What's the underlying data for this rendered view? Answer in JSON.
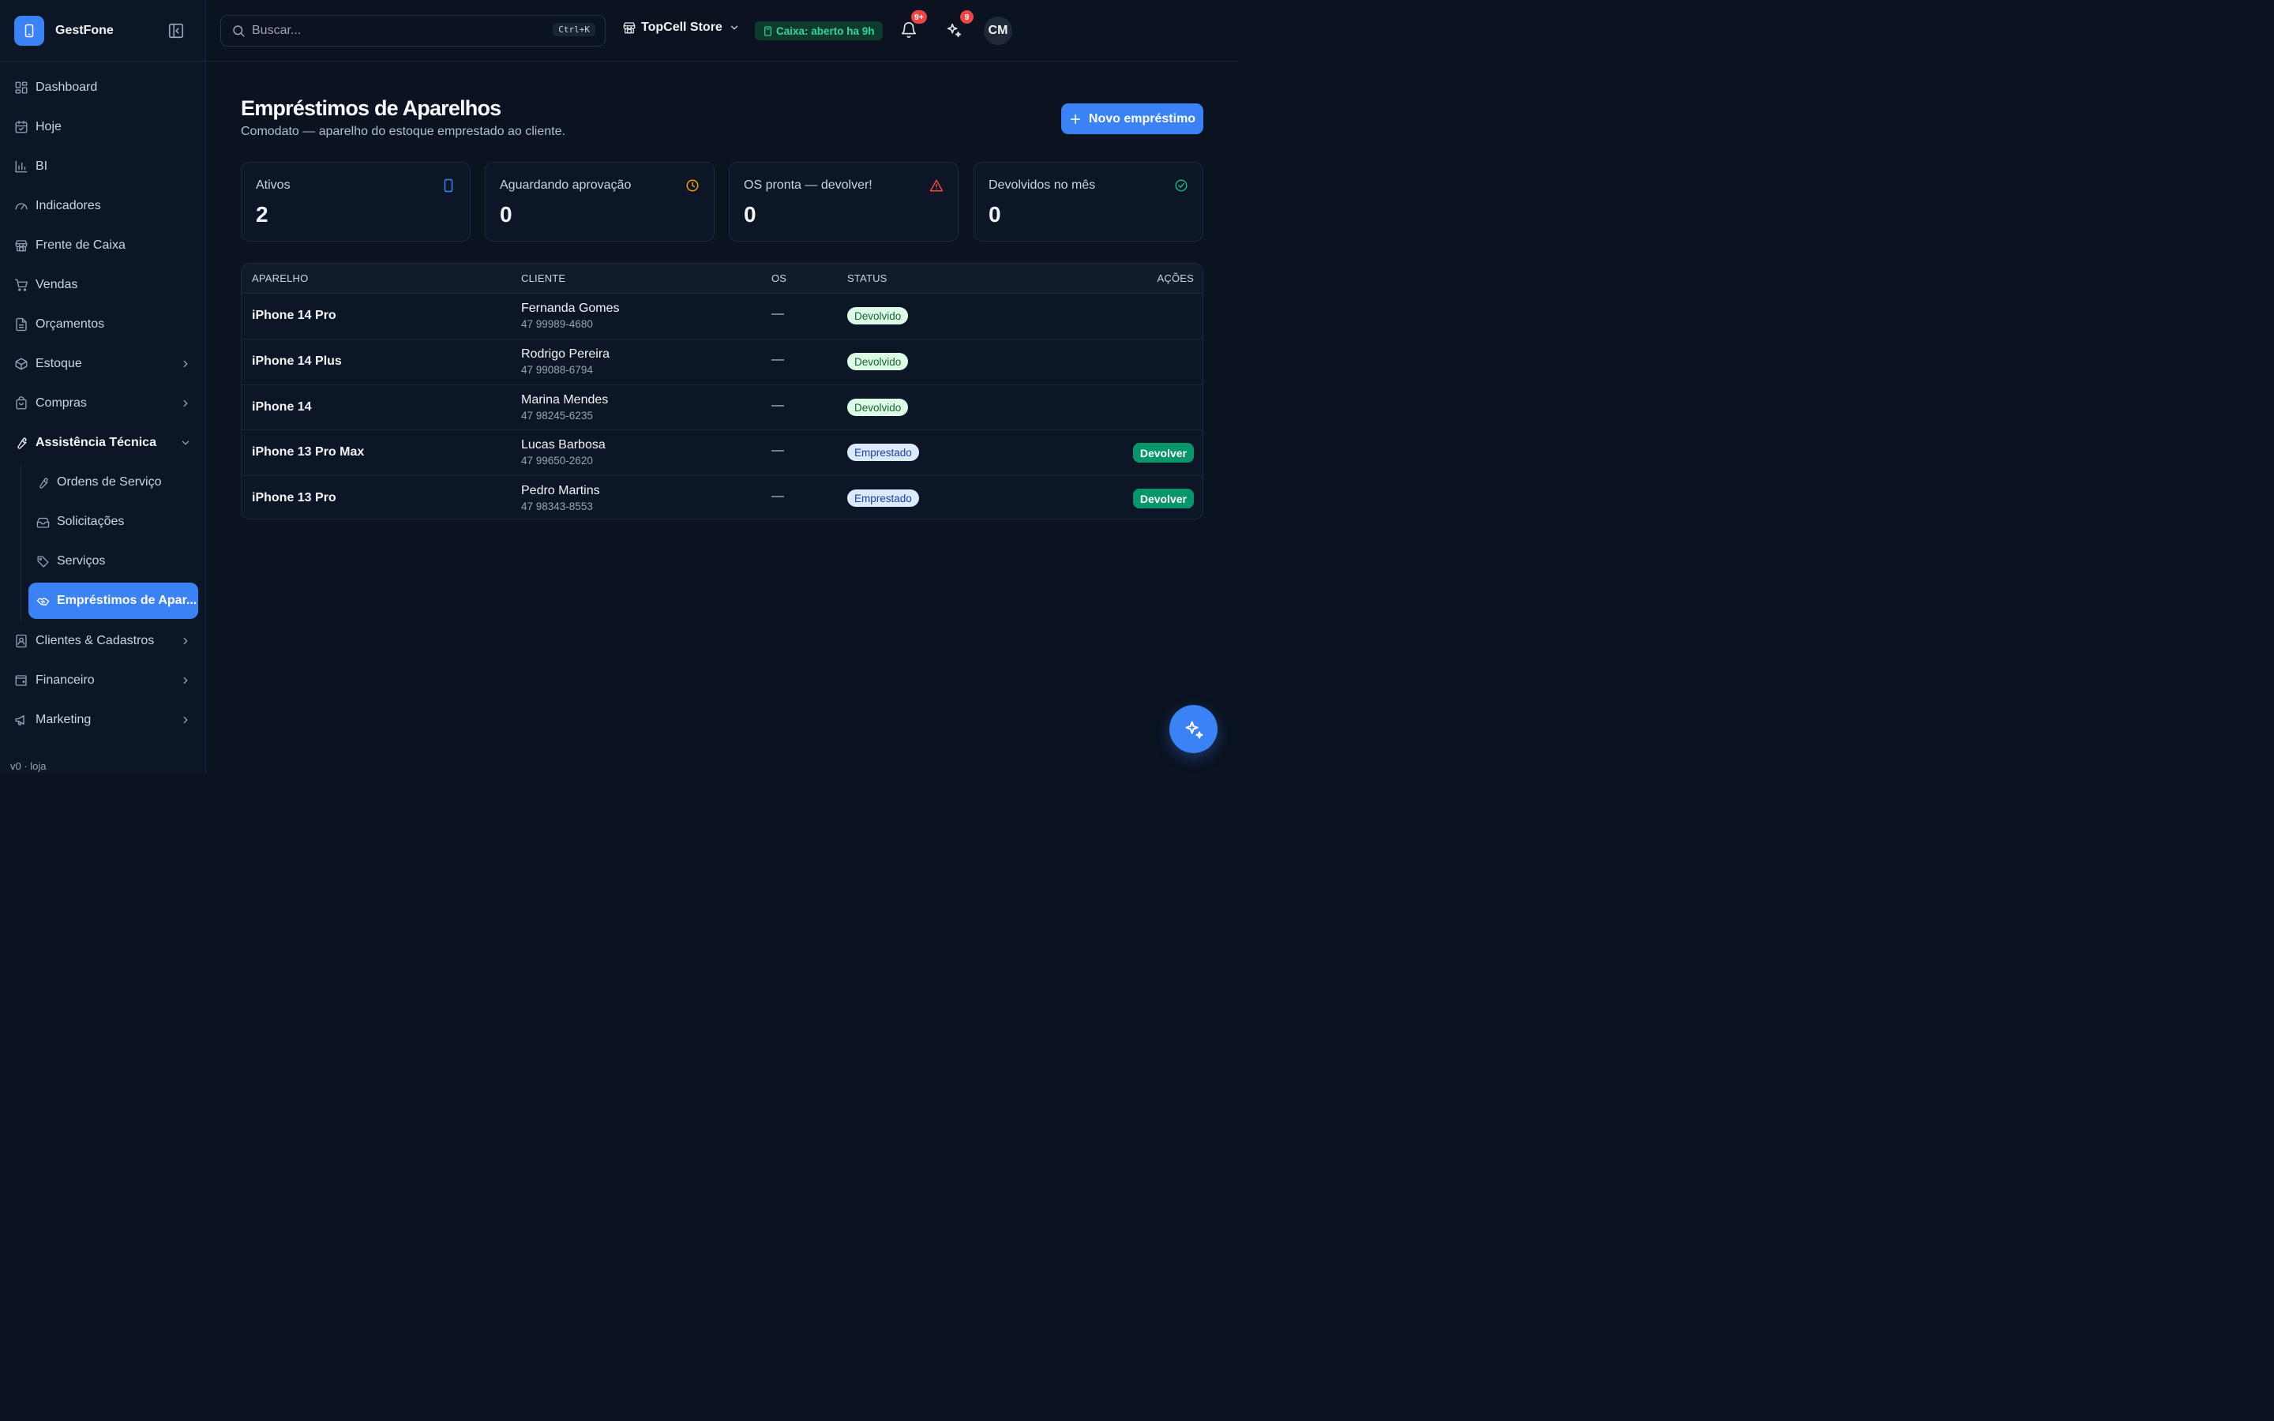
{
  "brand": {
    "name": "GestFone"
  },
  "sidebar": {
    "items": [
      {
        "label": "Dashboard",
        "icon": "dashboard-icon"
      },
      {
        "label": "Hoje",
        "icon": "calendar-icon"
      },
      {
        "label": "BI",
        "icon": "bar-chart-icon"
      },
      {
        "label": "Indicadores",
        "icon": "gauge-icon"
      },
      {
        "label": "Frente de Caixa",
        "icon": "store-icon"
      },
      {
        "label": "Vendas",
        "icon": "cart-icon"
      },
      {
        "label": "Orçamentos",
        "icon": "document-icon"
      },
      {
        "label": "Estoque",
        "icon": "package-icon"
      },
      {
        "label": "Compras",
        "icon": "shopping-bag-icon"
      },
      {
        "label": "Assistência Técnica",
        "icon": "wrench-icon"
      },
      {
        "label": "Clientes & Cadastros",
        "icon": "contact-icon"
      },
      {
        "label": "Financeiro",
        "icon": "wallet-icon"
      },
      {
        "label": "Marketing",
        "icon": "megaphone-icon"
      }
    ],
    "subitems": [
      {
        "label": "Ordens de Serviço",
        "icon": "wrench-icon"
      },
      {
        "label": "Solicitações",
        "icon": "inbox-icon"
      },
      {
        "label": "Serviços",
        "icon": "tags-icon"
      },
      {
        "label": "Empréstimos de Apar...",
        "icon": "handshake-icon"
      }
    ],
    "version": "v0 · loja"
  },
  "topbar": {
    "search_placeholder": "Buscar...",
    "search_shortcut": "Ctrl+K",
    "store_name": "TopCell Store",
    "caixa_status": "Caixa: aberto ha 9h",
    "notifications_badge": "9+",
    "ai_badge": "9",
    "avatar_initials": "CM"
  },
  "page": {
    "title": "Empréstimos de Aparelhos",
    "subtitle": "Comodato — aparelho do estoque emprestado ao cliente.",
    "new_button": "Novo empréstimo"
  },
  "stats": [
    {
      "label": "Ativos",
      "value": "2",
      "icon": "smartphone-icon",
      "color": "#3b82f6"
    },
    {
      "label": "Aguardando aprovação",
      "value": "0",
      "icon": "clock-icon",
      "color": "#f59e0b"
    },
    {
      "label": "OS pronta — devolver!",
      "value": "0",
      "icon": "alert-triangle-icon",
      "color": "#ef4444"
    },
    {
      "label": "Devolvidos no mês",
      "value": "0",
      "icon": "check-circle-icon",
      "color": "#10b981"
    }
  ],
  "table": {
    "headers": {
      "device": "APARELHO",
      "client": "CLIENTE",
      "os": "OS",
      "status": "STATUS",
      "actions": "AÇÕES"
    },
    "rows": [
      {
        "device": "iPhone 14 Pro",
        "client": "Fernanda Gomes",
        "phone": "47 99989-4680",
        "os": "—",
        "status": "Devolvido",
        "action": ""
      },
      {
        "device": "iPhone 14 Plus",
        "client": "Rodrigo Pereira",
        "phone": "47 99088-6794",
        "os": "—",
        "status": "Devolvido",
        "action": ""
      },
      {
        "device": "iPhone 14",
        "client": "Marina Mendes",
        "phone": "47 98245-6235",
        "os": "—",
        "status": "Devolvido",
        "action": ""
      },
      {
        "device": "iPhone 13 Pro Max",
        "client": "Lucas Barbosa",
        "phone": "47 99650-2620",
        "os": "—",
        "status": "Emprestado",
        "action": "Devolver"
      },
      {
        "device": "iPhone 13 Pro",
        "client": "Pedro Martins",
        "phone": "47 98343-8553",
        "os": "—",
        "status": "Emprestado",
        "action": "Devolver"
      }
    ]
  },
  "colors": {
    "accent": "#3b82f6",
    "success": "#059669",
    "background": "#0b1220"
  }
}
